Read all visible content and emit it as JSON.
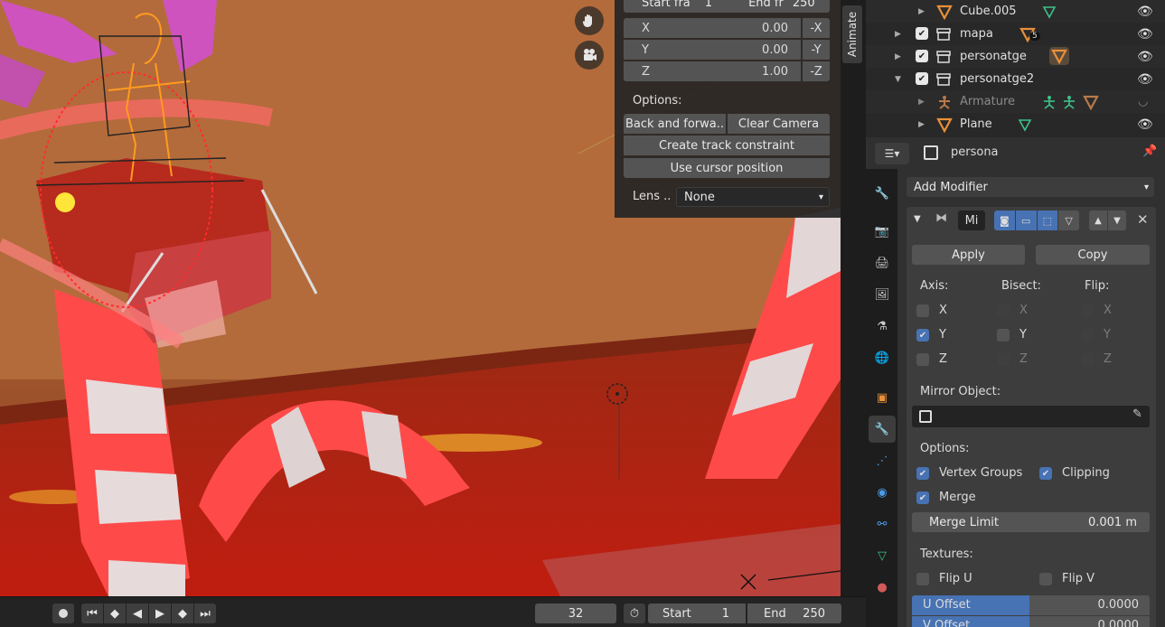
{
  "viewport": {
    "nav_icons": [
      "hand-icon",
      "camera-icon"
    ]
  },
  "npanel": {
    "start_frame_label": "Start fra",
    "start_frame_value": "1",
    "end_frame_label": "End fr",
    "end_frame_value": "250",
    "x_label": "X",
    "x_value": "0.00",
    "x_neg": "-X",
    "y_label": "Y",
    "y_value": "0.00",
    "y_neg": "-Y",
    "z_label": "Z",
    "z_value": "1.00",
    "z_neg": "-Z",
    "options_label": "Options:",
    "back_forward": "Back and forwa..",
    "clear_camera": "Clear Camera",
    "create_track": "Create track constraint",
    "use_cursor": "Use cursor position",
    "lens_label": "Lens ..",
    "lens_value": "None"
  },
  "animate_tab": "Animate",
  "outliner": {
    "rows": [
      {
        "name": "Cube.005"
      },
      {
        "name": "mapa",
        "badge": "5"
      },
      {
        "name": "personatge"
      },
      {
        "name": "personatge2"
      },
      {
        "name": "Armature"
      },
      {
        "name": "Plane"
      }
    ]
  },
  "properties": {
    "object_name": "persona",
    "add_modifier": "Add Modifier",
    "modifier_name": "Mi",
    "apply": "Apply",
    "copy": "Copy",
    "axis_label": "Axis:",
    "bisect_label": "Bisect:",
    "flip_label": "Flip:",
    "x": "X",
    "y": "Y",
    "z": "Z",
    "mirror_object_label": "Mirror Object:",
    "options_label": "Options:",
    "vertex_groups": "Vertex Groups",
    "clipping": "Clipping",
    "merge": "Merge",
    "merge_limit_label": "Merge Limit",
    "merge_limit_value": "0.001 m",
    "textures_label": "Textures:",
    "flip_u": "Flip U",
    "flip_v": "Flip V",
    "u_offset_label": "U Offset",
    "u_offset_value": "0.0000",
    "v_offset_label": "V Offset",
    "v_offset_value": "0.0000"
  },
  "timeline": {
    "current_frame": "32",
    "start_label": "Start",
    "start_value": "1",
    "end_label": "End",
    "end_value": "250"
  }
}
